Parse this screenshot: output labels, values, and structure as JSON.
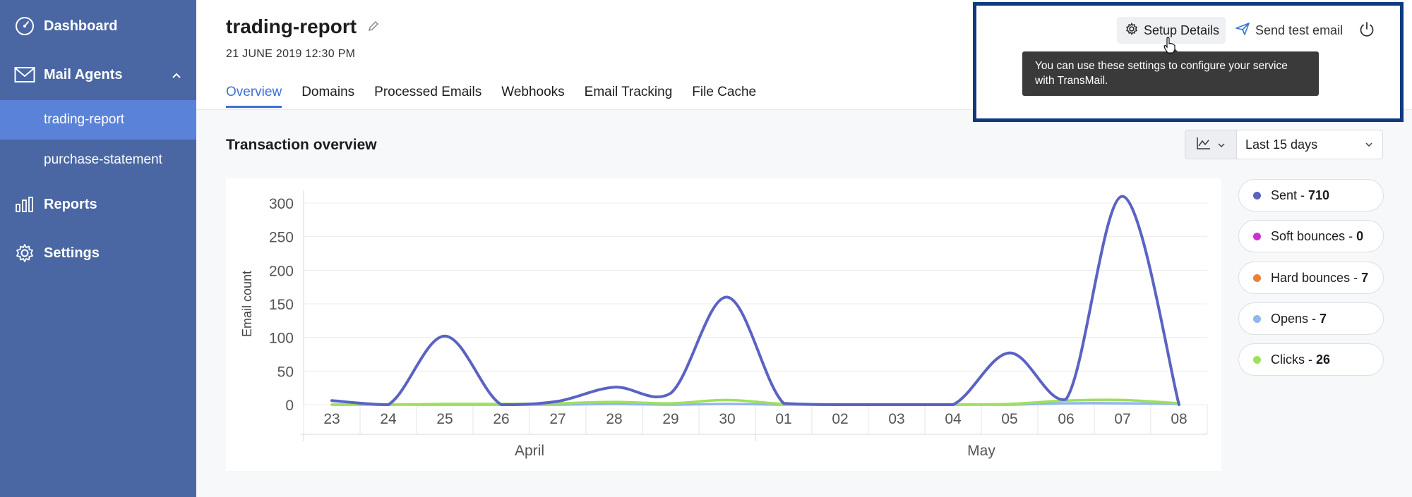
{
  "sidebar": {
    "items": [
      {
        "label": "Dashboard",
        "icon": "dashboard-gauge-icon"
      },
      {
        "label": "Mail Agents",
        "icon": "envelope-icon",
        "expanded": true
      },
      {
        "label": "Reports",
        "icon": "bar-chart-icon"
      },
      {
        "label": "Settings",
        "icon": "gear-icon"
      }
    ],
    "sub_items": [
      {
        "label": "trading-report",
        "active": true
      },
      {
        "label": "purchase-statement",
        "active": false
      }
    ]
  },
  "header": {
    "title": "trading-report",
    "date": "21 JUNE 2019 12:30 PM",
    "tabs": [
      "Overview",
      "Domains",
      "Processed Emails",
      "Webhooks",
      "Email Tracking",
      "File Cache"
    ],
    "active_tab": "Overview",
    "actions": {
      "setup_label": "Setup Details",
      "send_test_label": "Send test email",
      "power_icon": "power-icon"
    },
    "tooltip": "You can use these settings to configure your service with TransMail."
  },
  "overview": {
    "title": "Transaction overview",
    "range": "Last 15 days",
    "chart_type_icon": "line-chart-icon"
  },
  "legend": [
    {
      "label": "Sent",
      "value": "710",
      "color": "#5a63c3"
    },
    {
      "label": "Soft bounces",
      "value": "0",
      "color": "#c832d2"
    },
    {
      "label": "Hard bounces",
      "value": "7",
      "color": "#e9803d"
    },
    {
      "label": "Opens",
      "value": "7",
      "color": "#8fb8ec"
    },
    {
      "label": "Clicks",
      "value": "26",
      "color": "#9ee05a"
    }
  ],
  "chart_data": {
    "type": "line",
    "ylabel": "Email count",
    "xlabel": "",
    "ylim": [
      0,
      300
    ],
    "yticks": [
      0,
      50,
      100,
      150,
      200,
      250,
      300
    ],
    "categories": [
      "23",
      "24",
      "25",
      "26",
      "27",
      "28",
      "29",
      "30",
      "01",
      "02",
      "03",
      "04",
      "05",
      "06",
      "07",
      "08"
    ],
    "month_labels": [
      {
        "label": "April",
        "from": 0,
        "to": 7
      },
      {
        "label": "May",
        "from": 8,
        "to": 15
      }
    ],
    "series": [
      {
        "name": "Sent",
        "color": "#5a63c3",
        "values": [
          6,
          0,
          102,
          0,
          5,
          26,
          17,
          160,
          2,
          0,
          0,
          0,
          77,
          8,
          310,
          0
        ]
      },
      {
        "name": "Clicks",
        "color": "#9ee05a",
        "values": [
          0,
          0,
          1,
          1,
          2,
          4,
          2,
          7,
          1,
          0,
          0,
          0,
          1,
          6,
          7,
          2
        ]
      },
      {
        "name": "Opens",
        "color": "#8fb8ec",
        "values": [
          0,
          0,
          0,
          0,
          0,
          1,
          0,
          1,
          0,
          0,
          0,
          0,
          0,
          2,
          2,
          1
        ]
      }
    ]
  }
}
